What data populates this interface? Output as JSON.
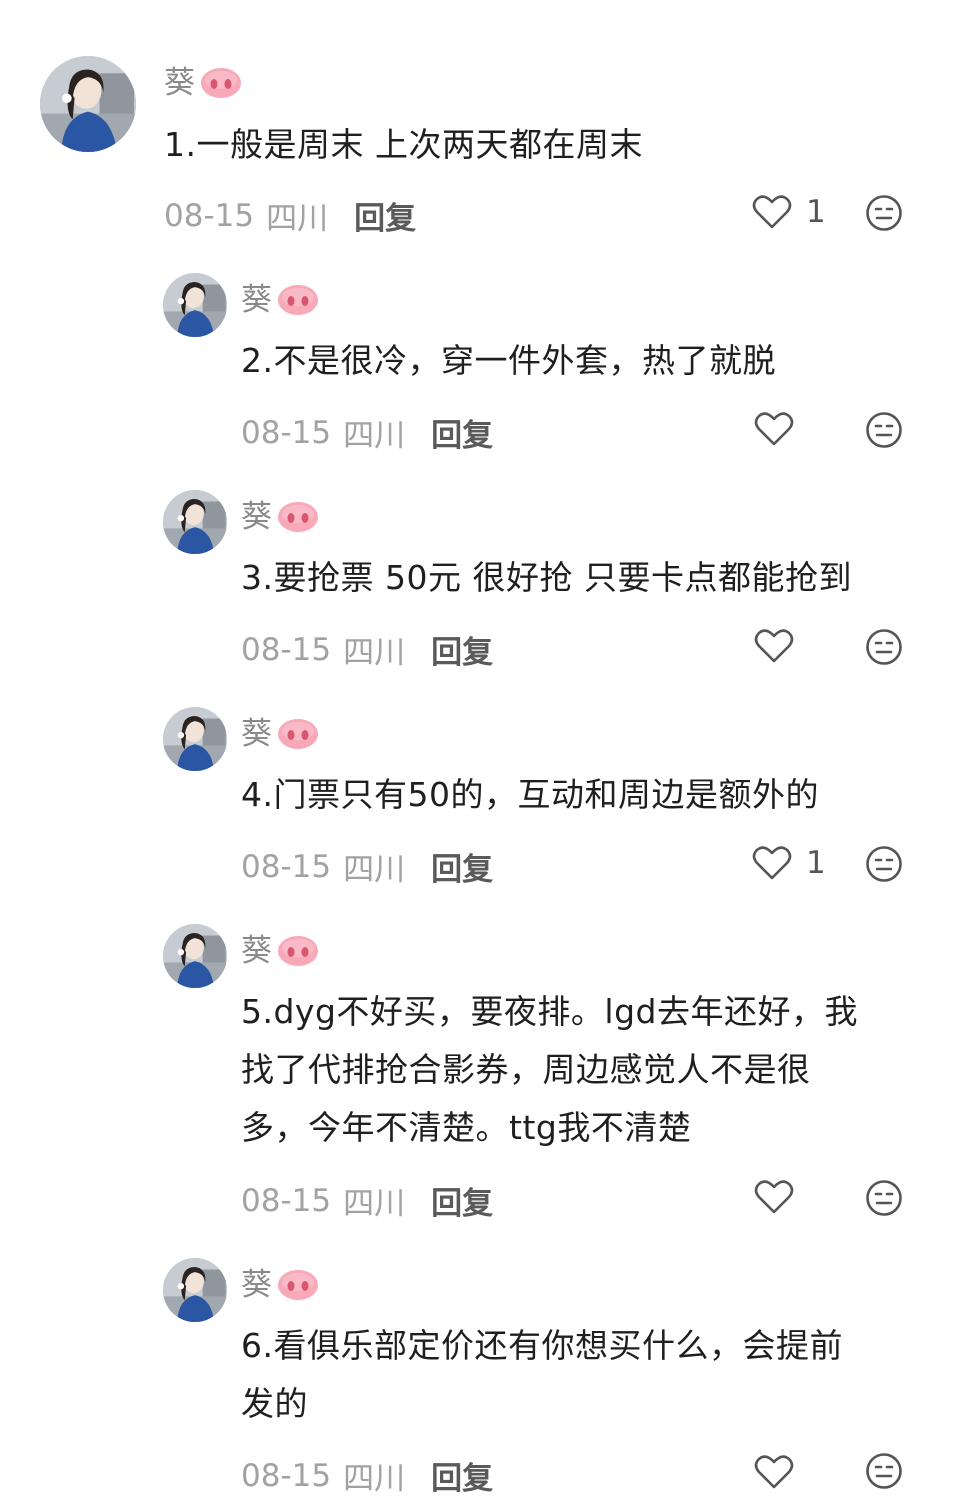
{
  "comments": [
    {
      "name": "葵",
      "text": "1.一般是周末 上次两天都在周末",
      "date": "08-15",
      "location": "四川",
      "reply_label": "回复",
      "likes": "1"
    },
    {
      "name": "葵",
      "text": "2.不是很冷，穿一件外套，热了就脱",
      "date": "08-15",
      "location": "四川",
      "reply_label": "回复",
      "likes": ""
    },
    {
      "name": "葵",
      "text": "3.要抢票 50元 很好抢 只要卡点都能抢到",
      "date": "08-15",
      "location": "四川",
      "reply_label": "回复",
      "likes": ""
    },
    {
      "name": "葵",
      "text": "4.门票只有50的，互动和周边是额外的",
      "date": "08-15",
      "location": "四川",
      "reply_label": "回复",
      "likes": "1"
    },
    {
      "name": "葵",
      "text_lines": [
        "5.dyg不好买，要夜排。lgd去年还好，我",
        "找了代排抢合影券，周边感觉人不是很",
        "多，今年不清楚。ttg我不清楚"
      ],
      "date": "08-15",
      "location": "四川",
      "reply_label": "回复",
      "likes": ""
    },
    {
      "name": "葵",
      "text_lines": [
        "6.看俱乐部定价还有你想买什么，会提前",
        "发的"
      ],
      "date": "08-15",
      "location": "四川",
      "reply_label": "回复",
      "likes": ""
    }
  ],
  "colors": {
    "pig": "#f7a9b8",
    "pig_dark": "#e8788f",
    "meta": "#a2a2a2"
  }
}
